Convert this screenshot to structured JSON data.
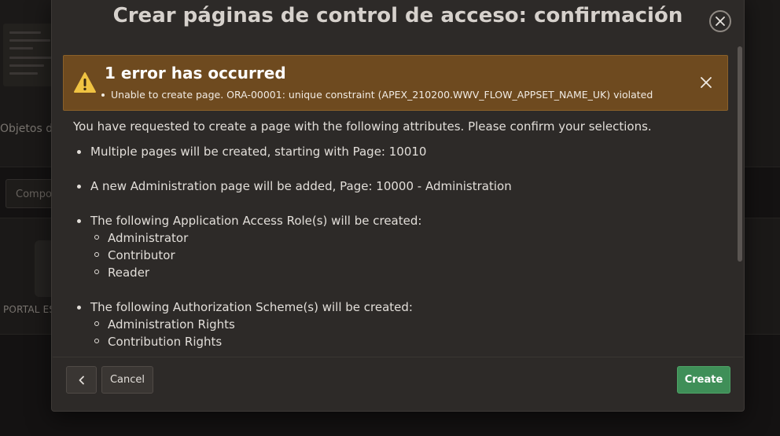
{
  "background": {
    "section_label": "Objetos d",
    "select_value": "Compor",
    "tile_label": "PORTAL ES"
  },
  "dialog": {
    "title": "Crear páginas de control de acceso: confirmación"
  },
  "alert": {
    "heading": "1 error has occurred",
    "message": "Unable to create page. ORA-00001: unique constraint (APEX_210200.WWV_FLOW_APPSET_NAME_UK) violated"
  },
  "content": {
    "intro": "You have requested to create a page with the following attributes. Please confirm your selections.",
    "items": [
      {
        "text": "Multiple pages will be created, starting with Page: 10010",
        "subitems": []
      },
      {
        "text": "A new Administration page will be added, Page: 10000 - Administration",
        "subitems": []
      },
      {
        "text": "The following Application Access Role(s) will be created:",
        "subitems": [
          "Administrator",
          "Contributor",
          "Reader"
        ]
      },
      {
        "text": "The following Authorization Scheme(s) will be created:",
        "subitems": [
          "Administration Rights",
          "Contribution Rights"
        ]
      }
    ]
  },
  "footer": {
    "cancel_label": "Cancel",
    "create_label": "Create"
  },
  "colors": {
    "alert_background": "#6e4a1f",
    "warning_icon": "#f0c342",
    "create_button": "#3f8f58"
  },
  "icons": {
    "back": "chevron-left-icon",
    "close": "close-icon",
    "warning": "warning-icon"
  }
}
